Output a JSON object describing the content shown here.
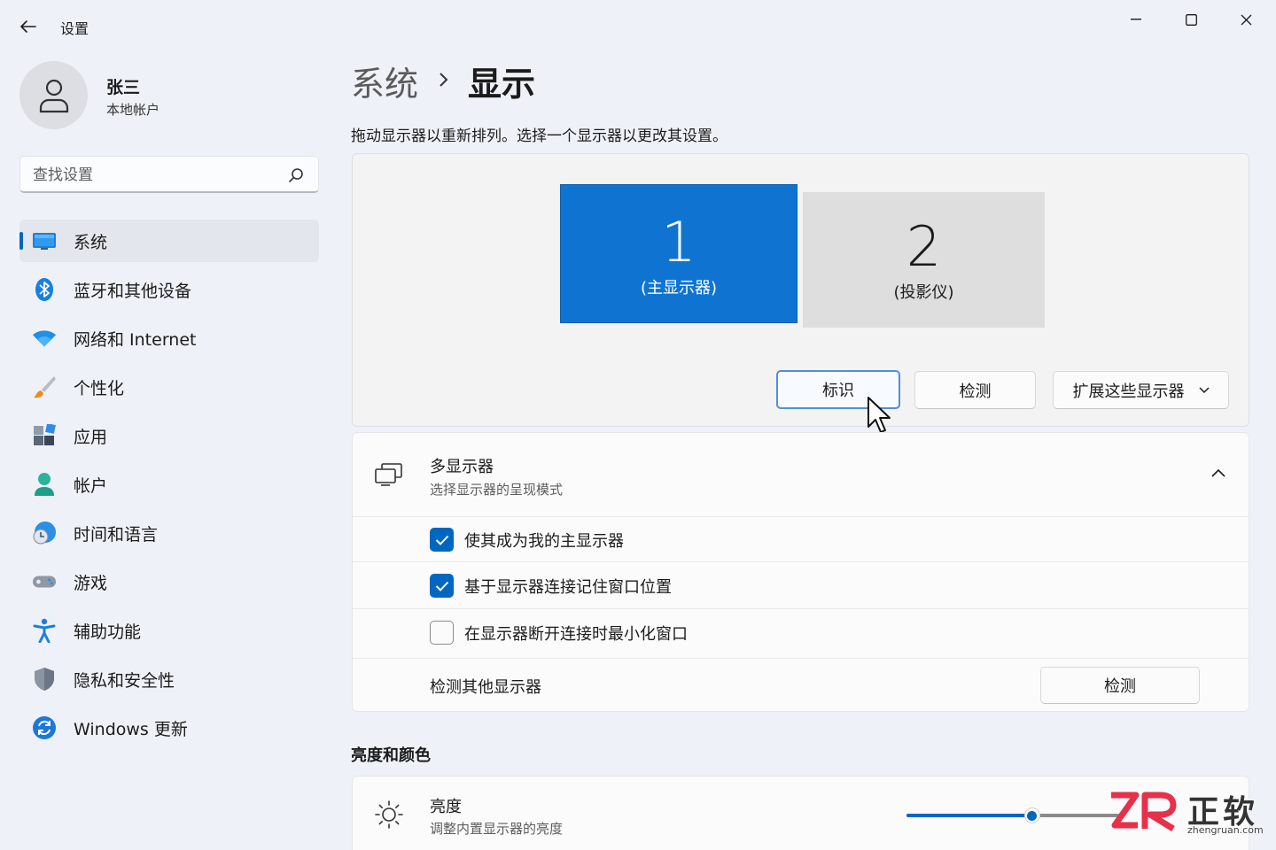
{
  "window": {
    "title": "设置"
  },
  "profile": {
    "name": "张三",
    "account_type": "本地帐户"
  },
  "search": {
    "placeholder": "查找设置"
  },
  "nav": {
    "items": [
      {
        "label": "系统",
        "icon": "monitor-icon",
        "active": true
      },
      {
        "label": "蓝牙和其他设备",
        "icon": "bluetooth-icon"
      },
      {
        "label": "网络和 Internet",
        "icon": "wifi-icon"
      },
      {
        "label": "个性化",
        "icon": "brush-icon"
      },
      {
        "label": "应用",
        "icon": "apps-icon"
      },
      {
        "label": "帐户",
        "icon": "person-icon"
      },
      {
        "label": "时间和语言",
        "icon": "globe-clock-icon"
      },
      {
        "label": "游戏",
        "icon": "gamepad-icon"
      },
      {
        "label": "辅助功能",
        "icon": "accessibility-icon"
      },
      {
        "label": "隐私和安全性",
        "icon": "shield-icon"
      },
      {
        "label": "Windows 更新",
        "icon": "update-icon"
      }
    ]
  },
  "breadcrumb": {
    "parent": "系统",
    "current": "显示"
  },
  "arrangement": {
    "intro": "拖动显示器以重新排列。选择一个显示器以更改其设置。",
    "monitors": [
      {
        "number": "1",
        "caption": "(主显示器)",
        "selected": true
      },
      {
        "number": "2",
        "caption": "(投影仪)",
        "selected": false
      }
    ],
    "identify_label": "标识",
    "detect_label": "检测",
    "extend_label": "扩展这些显示器"
  },
  "multi_display": {
    "title": "多显示器",
    "subtitle": "选择显示器的呈现模式",
    "options": [
      {
        "label": "使其成为我的主显示器",
        "checked": true
      },
      {
        "label": "基于显示器连接记住窗口位置",
        "checked": true
      },
      {
        "label": "在显示器断开连接时最小化窗口",
        "checked": false
      }
    ],
    "detect_other_label": "检测其他显示器",
    "detect_button": "检测"
  },
  "brightness": {
    "section_title": "亮度和颜色",
    "title": "亮度",
    "subtitle": "调整内置显示器的亮度",
    "level": 0.59
  },
  "watermark": {
    "text": "正软",
    "url": "zhengruan.com"
  },
  "colors": {
    "accent": "#0067c0",
    "monitor_selected": "#0f74d1",
    "monitor_idle": "#dedede"
  }
}
